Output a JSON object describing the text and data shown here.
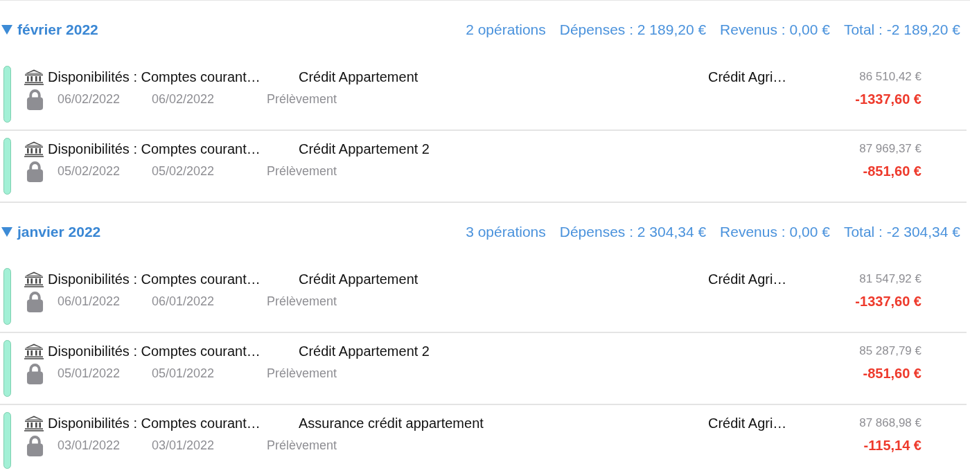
{
  "months": [
    {
      "title": "février 2022",
      "expanded": true,
      "summary": [
        "2 opérations",
        "Dépenses : 2 189,20 €",
        "Revenus : 0,00 €",
        "Total : -2 189,20 €"
      ],
      "transactions": [
        {
          "account": "Disponibilités : Comptes courant…",
          "description": "Crédit Appartement",
          "payee": "Crédit Agri…",
          "balance": "86 510,42 €",
          "locked": true,
          "date": "06/02/2022",
          "value_date": "06/02/2022",
          "type": "Prélèvement",
          "amount": "-1337,60 €",
          "color": "#a3f0d6"
        },
        {
          "account": "Disponibilités : Comptes courant…",
          "description": "Crédit Appartement 2",
          "balance": "87 969,37 €",
          "locked": true,
          "date": "05/02/2022",
          "value_date": "05/02/2022",
          "type": "Prélèvement",
          "amount": "-851,60 €",
          "color": "#a3f0d6"
        }
      ]
    },
    {
      "title": "janvier 2022",
      "expanded": true,
      "summary": [
        "3 opérations",
        "Dépenses : 2 304,34 €",
        "Revenus : 0,00 €",
        "Total : -2 304,34 €"
      ],
      "transactions": [
        {
          "account": "Disponibilités : Comptes courant…",
          "description": "Crédit Appartement",
          "payee": "Crédit Agri…",
          "balance": "81 547,92 €",
          "locked": true,
          "date": "06/01/2022",
          "value_date": "06/01/2022",
          "type": "Prélèvement",
          "amount": "-1337,60 €",
          "color": "#a3f0d6"
        },
        {
          "account": "Disponibilités : Comptes courant…",
          "description": "Crédit Appartement 2",
          "balance": "85 287,79 €",
          "locked": true,
          "date": "05/01/2022",
          "value_date": "05/01/2022",
          "type": "Prélèvement",
          "amount": "-851,60 €",
          "color": "#a3f0d6"
        },
        {
          "account": "Disponibilités : Comptes courant…",
          "description": "Assurance crédit appartement",
          "payee": "Crédit Agri…",
          "balance": "87 868,98 €",
          "locked": true,
          "date": "03/01/2022",
          "value_date": "03/01/2022",
          "type": "Prélèvement",
          "amount": "-115,14 €",
          "color": "#a3f0d6"
        }
      ]
    }
  ]
}
